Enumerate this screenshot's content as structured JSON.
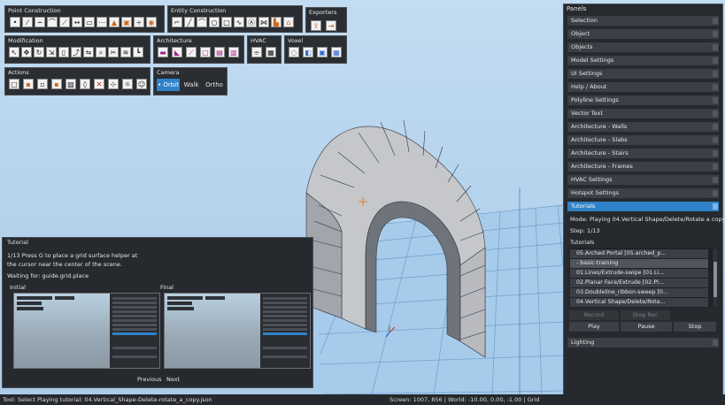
{
  "toolbar": {
    "point_construction": {
      "title": "Point Construction"
    },
    "entity_construction": {
      "title": "Entity Construction"
    },
    "exporters": {
      "title": "Exporters"
    },
    "modification": {
      "title": "Modification"
    },
    "architecture": {
      "title": "Architecture"
    },
    "hvac": {
      "title": "HVAC"
    },
    "voxel": {
      "title": "Voxel"
    },
    "actions": {
      "title": "Actions"
    },
    "camera": {
      "title": "Camera",
      "modes": [
        "• Orbit",
        "Walk",
        "Ortho"
      ]
    }
  },
  "panels": {
    "title": "Panels",
    "sections": [
      "Selection",
      "Object",
      "Objects",
      "Model Settings",
      "UI Settings",
      "Help / About",
      "Polyline Settings",
      "Vector Text",
      "Architecture - Walls",
      "Architecture - Slabs",
      "Architecture - Stairs",
      "Architecture - Frames",
      "HVAC Settings",
      "Hotspot Settings",
      "Tutorials"
    ],
    "tutorials": {
      "mode_text": "Mode: Playing 04.Vertical Shape/Delete/Rotate a copy",
      "step_text": "Step: 1/13",
      "list_label": "Tutorials",
      "items": [
        "05.Arched Portal [05.arched_p...",
        "- basic-training",
        "01.Lines/Extrude-swipe [01.Li...",
        "02.Planar Face/Extrude [02.Pl...",
        "03.Doubleline_ribbon-sweep [0...",
        "04.Vertical Shape/Delete/Rota..."
      ],
      "record_label": "Record",
      "stop_rec_label": "Stop Rec",
      "play_label": "Play",
      "pause_label": "Pause",
      "stop_label": "Stop"
    },
    "lighting_label": "Lighting"
  },
  "tutorial_window": {
    "title": "Tutorial",
    "step_line1": "1/13 Press G to place a grid surface helper at",
    "step_line2": "the cursor near the center of the scene.",
    "waiting": "Waiting for: guide.grid.place",
    "initial_label": "Initial",
    "final_label": "Final",
    "previous_label": "Previous",
    "next_label": "Next"
  },
  "status": {
    "left": "Tool: Select Playing tutorial: 04.Vertical_Shape-Delete-rotate_a_copy.json",
    "right": "Screen: 1007, 856 | World: -10.00, 0.00, -1.00 | Grid"
  },
  "colors": {
    "sky": "#b4d2ec",
    "ground": "#aed0ec",
    "grid_line": "#5c8fc6",
    "accent": "#2f82c7",
    "panel_bg": "#26292d"
  }
}
